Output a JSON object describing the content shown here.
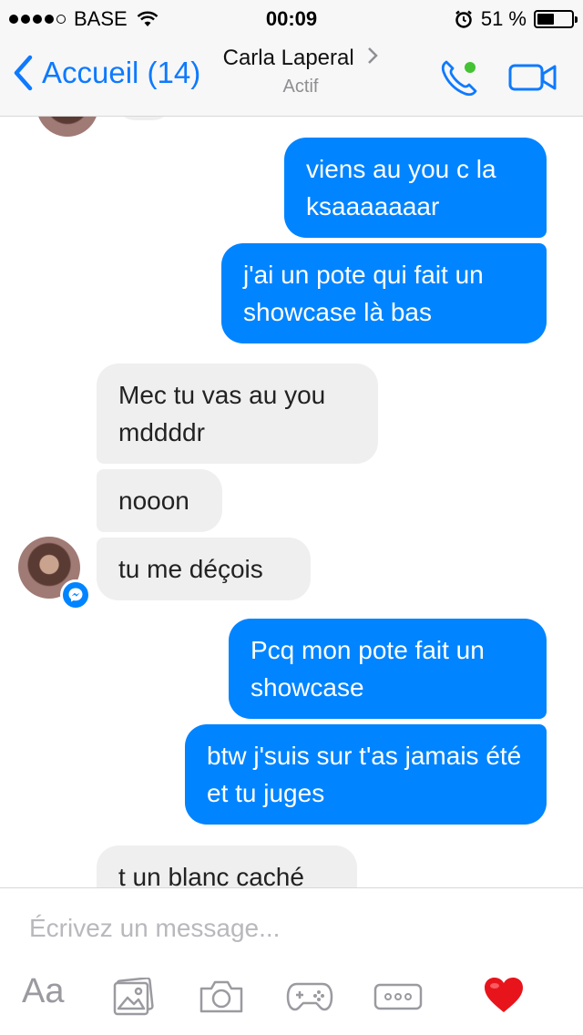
{
  "status_bar": {
    "carrier": "BASE",
    "time": "00:09",
    "battery": "51 %",
    "battery_level": 0.51
  },
  "nav": {
    "back_label": "Accueil (14)",
    "contact_name": "Carla Laperal",
    "contact_status": "Actif"
  },
  "messages": [
    {
      "dir": "out",
      "text": "viens au you c la ksaaaaaaar"
    },
    {
      "dir": "out",
      "text": "j'ai un pote qui fait un showcase là bas"
    },
    {
      "dir": "in",
      "text": "Mec tu vas au you mddddr"
    },
    {
      "dir": "in",
      "text": "nooon"
    },
    {
      "dir": "in",
      "text": "tu me déçois"
    },
    {
      "dir": "out",
      "text": "Pcq mon pote fait un showcase"
    },
    {
      "dir": "out",
      "text": "btw j'suis sur t'as jamais été et tu juges"
    },
    {
      "dir": "in",
      "text": "t un blanc caché"
    }
  ],
  "composer": {
    "placeholder": "Écrivez un message...",
    "text_tool": "Aa"
  },
  "icons": {
    "back": "chevron-left-icon",
    "call": "phone-icon",
    "video": "video-camera-icon",
    "photos": "photo-gallery-icon",
    "camera": "camera-icon",
    "games": "gamepad-icon",
    "more": "more-icon",
    "like": "heart-icon",
    "messenger": "messenger-icon"
  },
  "colors": {
    "accent": "#0e7afe",
    "outgoing_bubble": "#0084ff",
    "incoming_bubble": "#efeff0",
    "online": "#44c234",
    "heart": "#e8141b"
  }
}
